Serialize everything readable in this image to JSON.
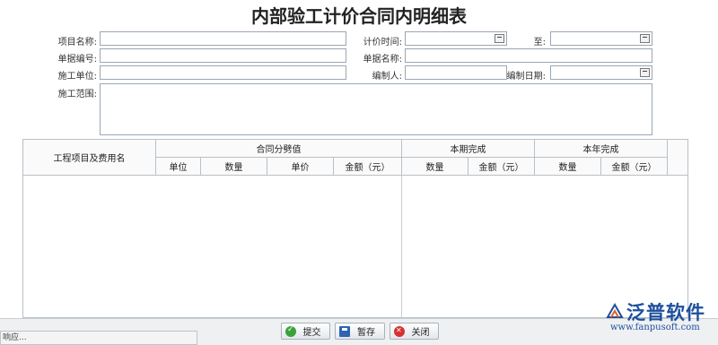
{
  "title": "内部验工计价合同内明细表",
  "form": {
    "project_name_label": "项目名称:",
    "bill_no_label": "单据编号:",
    "contractor_label": "施工单位:",
    "scope_label": "施工范围:",
    "pricing_time_label": "计价时间:",
    "to_label": "至:",
    "bill_name_label": "单据名称:",
    "author_label": "编制人:",
    "author_date_label": "编制日期:",
    "project_name_value": "",
    "bill_no_value": "",
    "contractor_value": "",
    "scope_value": "",
    "pricing_time_from": "",
    "pricing_time_to": "",
    "bill_name_value": "",
    "author_value": "",
    "author_date_value": ""
  },
  "grid": {
    "item_header": "工程项目及费用名",
    "group_contract": "合同分劈值",
    "group_period": "本期完成",
    "group_year": "本年完成",
    "col_unit": "单位",
    "col_qty": "数量",
    "col_price": "单价",
    "col_amount": "金额（元）",
    "col_period_qty": "数量",
    "col_period_amount": "金额（元）",
    "col_year_qty": "数量",
    "col_year_amount": "金额（元）"
  },
  "buttons": {
    "submit": "提交",
    "save": "暂存",
    "close": "关闭"
  },
  "status_text": "响应...",
  "logo": {
    "brand": "泛普软件",
    "url": "www.fanpusoft.com"
  },
  "icons": [
    "calendar-icon",
    "submit-check-icon",
    "save-disk-icon",
    "close-x-icon",
    "fanpu-logo-icon"
  ]
}
